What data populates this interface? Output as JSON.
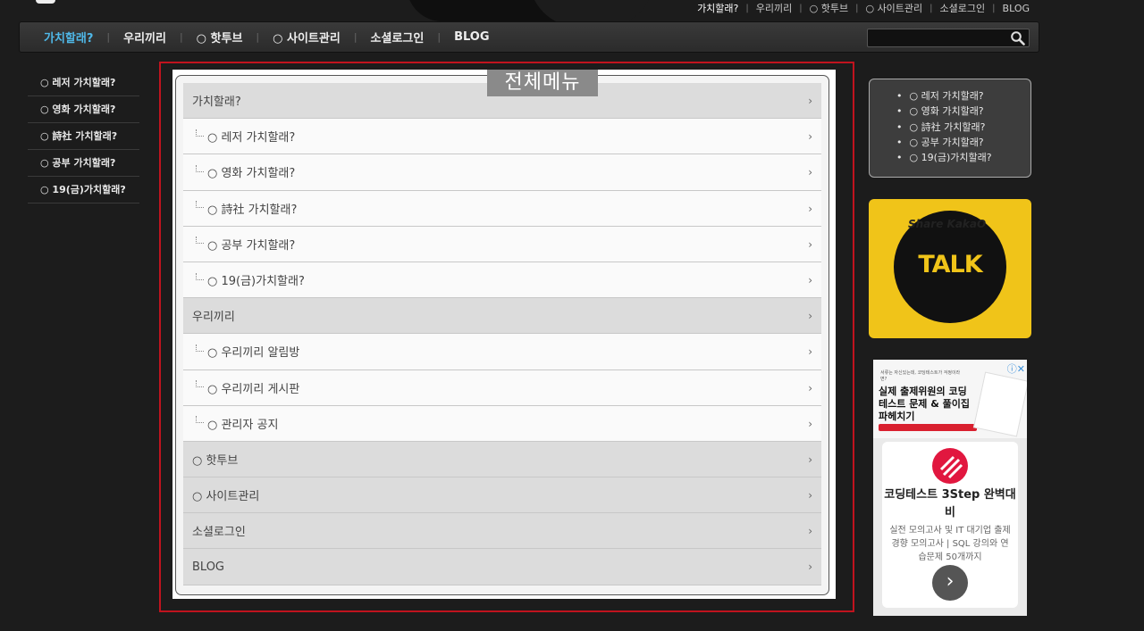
{
  "top_links": [
    "가치할래?",
    "우리끼리",
    "○ 핫투브",
    "○ 사이트관리",
    "소셜로그인",
    "BLOG"
  ],
  "nav": {
    "items": [
      "가치할래?",
      "우리끼리",
      "○ 핫투브",
      "○ 사이트관리",
      "소셜로그인",
      "BLOG"
    ],
    "search_placeholder": ""
  },
  "left_menu": [
    "○ 레저 가치할래?",
    "○ 영화 가치할래?",
    "○ 詩社 가치할래?",
    "○ 공부 가치할래?",
    "○ 19(금)가치할래?"
  ],
  "full_menu": {
    "title": "전체메뉴",
    "rows": [
      {
        "label": "가치할래?",
        "level": "top"
      },
      {
        "label": "○ 레저 가치할래?",
        "level": "sub"
      },
      {
        "label": "○ 영화 가치할래?",
        "level": "sub"
      },
      {
        "label": "○ 詩社 가치할래?",
        "level": "sub"
      },
      {
        "label": "○ 공부 가치할래?",
        "level": "sub"
      },
      {
        "label": "○ 19(금)가치할래?",
        "level": "sub"
      },
      {
        "label": "우리끼리",
        "level": "top"
      },
      {
        "label": "○ 우리끼리 알림방",
        "level": "sub"
      },
      {
        "label": "○ 우리끼리 게시판",
        "level": "sub"
      },
      {
        "label": "○ 관리자 공지",
        "level": "sub"
      },
      {
        "label": "○ 핫투브",
        "level": "top"
      },
      {
        "label": "○ 사이트관리",
        "level": "top"
      },
      {
        "label": "소셜로그인",
        "level": "top"
      },
      {
        "label": "BLOG",
        "level": "top"
      }
    ],
    "arrow": "›"
  },
  "right_box": [
    "○ 레저 가치할래?",
    "○ 영화 가치할래?",
    "○ 詩社 가치할래?",
    "○ 공부 가치할래?",
    "○ 19(금)가치할래?"
  ],
  "kakao": {
    "share": "Share KakaO",
    "talk": "TALK",
    "color": "#f0c419"
  },
  "ad": {
    "small_text": "서류는 자신있는데, 코딩테스트가 걱정이라면?",
    "headline": "실제 출제위원의 코딩 테스트 문제 & 풀이집 파헤치기",
    "card_title": "코딩테스트 3Step 완벽대비",
    "card_desc": "실전 모의고사 및 IT 대기업 출제 경향 모의고사 | SQL 강의와 연습문제 50개까지",
    "close": "ⓘ✕",
    "button": "›"
  },
  "colors": {
    "accent": "#4fb8e8",
    "frame": "#c0131e"
  }
}
